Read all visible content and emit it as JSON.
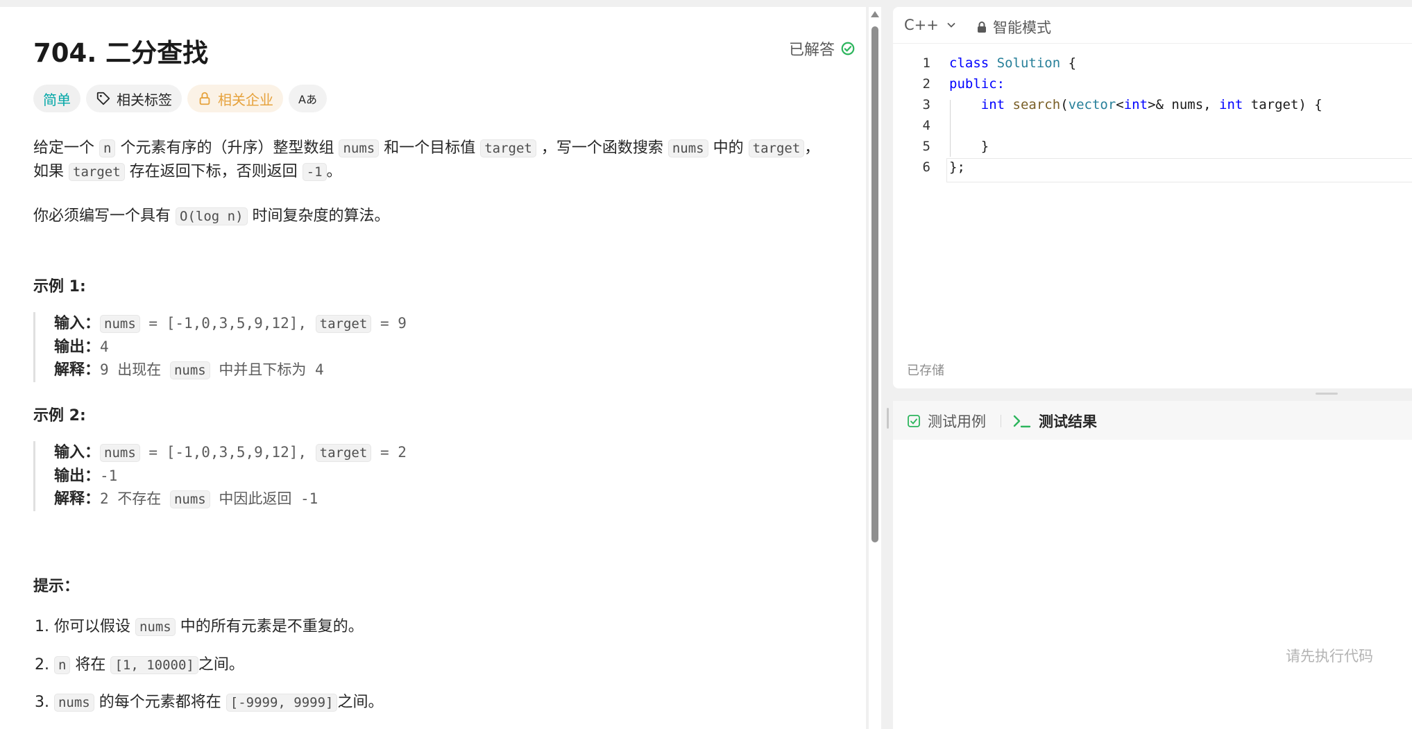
{
  "problem": {
    "title": "704. 二分查找",
    "status": "已解答",
    "tags": {
      "difficulty": "简单",
      "related_tags": "相关标签",
      "related_companies": "相关企业",
      "translate": "Aあ"
    },
    "description": {
      "p1_a": "给定一个 ",
      "p1_n": "n",
      "p1_b": " 个元素有序的（升序）整型数组 ",
      "p1_nums": "nums",
      "p1_c": " 和一个目标值 ",
      "p1_target": "target",
      "p1_d": " ，写一个函数搜索 ",
      "p1_nums2": "nums",
      "p1_e": " 中的 ",
      "p1_target2": "target",
      "p1_f": "，",
      "p2_a": "如果 ",
      "p2_target": "target",
      "p2_b": " 存在返回下标，否则返回 ",
      "p2_neg": "-1",
      "p2_c": "。",
      "p3_a": "你必须编写一个具有 ",
      "p3_code": "O(log n)",
      "p3_b": " 时间复杂度的算法。"
    },
    "examples": [
      {
        "title": "示例 1:",
        "input_label": "输入：",
        "input_nums": "nums",
        "input_mid": " = [-1,0,3,5,9,12], ",
        "input_target": "target",
        "input_end": " = 9",
        "output_label": "输出：",
        "output": "4",
        "explain_label": "解释：",
        "explain_a": "9 出现在 ",
        "explain_nums": "nums",
        "explain_b": " 中并且下标为 4"
      },
      {
        "title": "示例 2:",
        "input_label": "输入：",
        "input_nums": "nums",
        "input_mid": " = [-1,0,3,5,9,12], ",
        "input_target": "target",
        "input_end": " = 2",
        "output_label": "输出：",
        "output": "-1",
        "explain_label": "解释：",
        "explain_a": "2 不存在 ",
        "explain_nums": "nums",
        "explain_b": " 中因此返回 -1"
      }
    ],
    "hints": {
      "title": "提示：",
      "h1_a": "1. 你可以假设 ",
      "h1_code": "nums",
      "h1_b": " 中的所有元素是不重复的。",
      "h2_a": "2. ",
      "h2_code1": "n",
      "h2_b": " 将在 ",
      "h2_code2": "[1, 10000]",
      "h2_c": "之间。",
      "h3_a": "3. ",
      "h3_code1": "nums",
      "h3_b": " 的每个元素都将在 ",
      "h3_code2": "[-9999, 9999]",
      "h3_c": "之间。"
    }
  },
  "editor": {
    "language": "C++",
    "mode": "智能模式",
    "saved_status": "已存储",
    "line_numbers": [
      "1",
      "2",
      "3",
      "4",
      "5",
      "6"
    ],
    "code": {
      "l1_kw": "class",
      "l1_name": "Solution",
      "l1_brace": " {",
      "l2": "public:",
      "l3_indent": "    ",
      "l3_int": "int",
      "l3_fn": "search",
      "l3_open": "(",
      "l3_vec": "vector",
      "l3_lt": "<",
      "l3_int2": "int",
      "l3_gt": ">&",
      "l3_nums": " nums, ",
      "l3_int3": "int",
      "l3_rest": " target) {",
      "l5": "    }",
      "l6": "};"
    }
  },
  "test_panel": {
    "tab_testcases": "测试用例",
    "tab_results": "测试结果",
    "run_hint": "请先执行代码"
  },
  "colors": {
    "accent_green": "#2db55d",
    "easy_teal": "#00a6a6",
    "company_orange": "#e6a23c",
    "keyword_blue": "#0000ff"
  }
}
